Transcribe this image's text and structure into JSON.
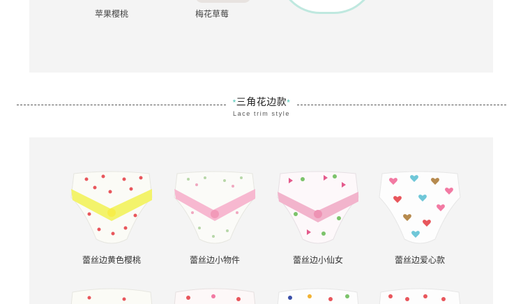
{
  "top_section": {
    "items": [
      {
        "label": "苹果樱桃"
      },
      {
        "label": "梅花草莓"
      }
    ]
  },
  "section_heading": {
    "star_left": "*",
    "title": "三角花边款",
    "star_right": "*",
    "subtitle": "Lace trim style"
  },
  "products": [
    {
      "label": "蕾丝边黄色樱桃",
      "lace_color": "#f3f36b",
      "print": "cherry"
    },
    {
      "label": "蕾丝边小物件",
      "lace_color": "#f7b8d0",
      "print": "small-items"
    },
    {
      "label": "蕾丝边小仙女",
      "lace_color": "#f2b4cc",
      "print": "fairy"
    },
    {
      "label": "蕾丝边爱心款",
      "lace_color": "#ffffff",
      "print": "hearts"
    }
  ],
  "colors": {
    "accent_star": "#4fc7b8",
    "panel_bg": "#f4f4f4"
  }
}
